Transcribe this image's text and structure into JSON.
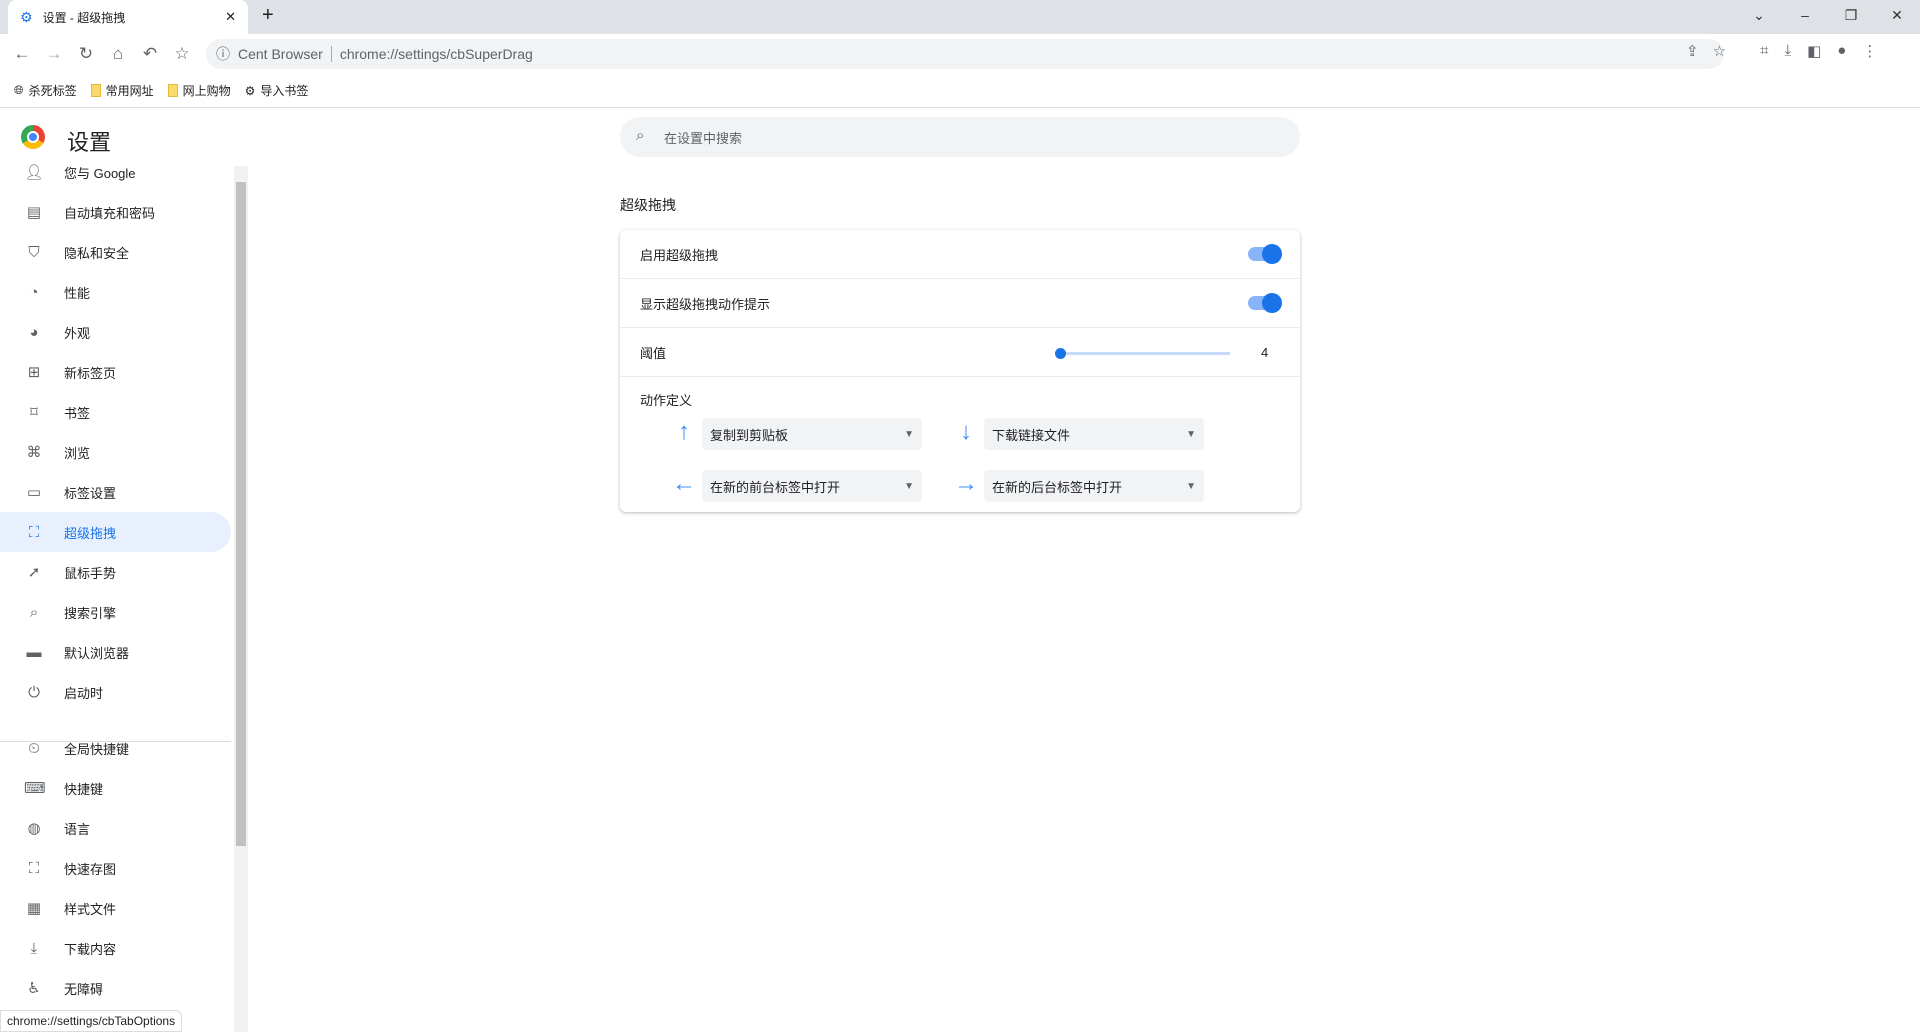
{
  "browser": {
    "tab_title": "设置 - 超级拖拽",
    "omnibox_label": "Cent Browser",
    "url": "chrome://settings/cbSuperDrag",
    "status_url": "chrome://settings/cbTabOptions"
  },
  "bookmarks": [
    {
      "label": "杀死标签",
      "icon": "globe-icon"
    },
    {
      "label": "常用网址",
      "icon": "folder-icon"
    },
    {
      "label": "网上购物",
      "icon": "folder-icon"
    },
    {
      "label": "导入书签",
      "icon": "gear-icon"
    }
  ],
  "settings": {
    "title": "设置",
    "search_placeholder": "在设置中搜索"
  },
  "sidebar": {
    "items": [
      {
        "label": "您与 Google",
        "icon": "person-icon"
      },
      {
        "label": "自动填充和密码",
        "icon": "clipboard-icon"
      },
      {
        "label": "隐私和安全",
        "icon": "shield-icon"
      },
      {
        "label": "性能",
        "icon": "speedometer-icon"
      },
      {
        "label": "外观",
        "icon": "palette-icon"
      },
      {
        "label": "新标签页",
        "icon": "new-tab-icon"
      },
      {
        "label": "书签",
        "icon": "bookmark-icon"
      },
      {
        "label": "浏览",
        "icon": "browse-icon"
      },
      {
        "label": "标签设置",
        "icon": "tab-icon"
      },
      {
        "label": "超级拖拽",
        "icon": "super-drag-icon",
        "active": true
      },
      {
        "label": "鼠标手势",
        "icon": "cursor-icon"
      },
      {
        "label": "搜索引擎",
        "icon": "search-icon"
      },
      {
        "label": "默认浏览器",
        "icon": "browser-icon"
      },
      {
        "label": "启动时",
        "icon": "power-icon"
      },
      {
        "label": "全局快捷键",
        "icon": "global-shortcut-icon"
      },
      {
        "label": "快捷键",
        "icon": "keyboard-icon"
      },
      {
        "label": "语言",
        "icon": "globe-icon"
      },
      {
        "label": "快速存图",
        "icon": "screenshot-icon"
      },
      {
        "label": "样式文件",
        "icon": "style-file-icon"
      },
      {
        "label": "下载内容",
        "icon": "download-icon"
      },
      {
        "label": "无障碍",
        "icon": "accessibility-icon"
      }
    ]
  },
  "section": {
    "title": "超级拖拽",
    "enable_label": "启用超级拖拽",
    "enable_on": true,
    "hint_label": "显示超级拖拽动作提示",
    "hint_on": true,
    "threshold_label": "阈值",
    "threshold_value": "4",
    "actions_label": "动作定义",
    "actions": {
      "up": "复制到剪贴板",
      "down": "下载链接文件",
      "left": "在新的前台标签中打开",
      "right": "在新的后台标签中打开"
    }
  }
}
